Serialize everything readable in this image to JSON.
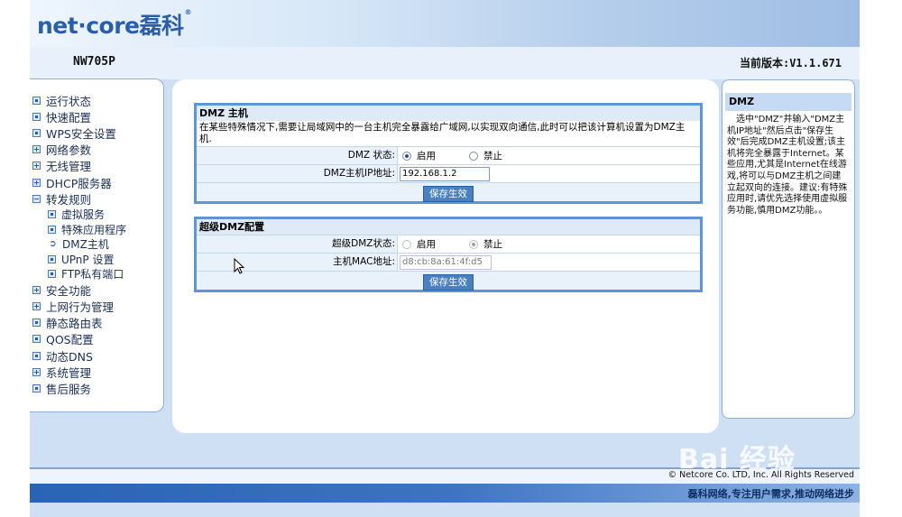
{
  "header": {
    "logo_text": "net·core磊科",
    "reg_mark": "®",
    "model": "NW705P",
    "version": "当前版本:V1.1.671"
  },
  "sidebar": {
    "items": [
      {
        "label": "运行状态",
        "icon": "dot",
        "indent": false
      },
      {
        "label": "快速配置",
        "icon": "dot",
        "indent": false
      },
      {
        "label": "WPS安全设置",
        "icon": "dot",
        "indent": false
      },
      {
        "label": "网络参数",
        "icon": "plus",
        "indent": false
      },
      {
        "label": "无线管理",
        "icon": "plus",
        "indent": false
      },
      {
        "label": "DHCP服务器",
        "icon": "plus",
        "indent": false
      },
      {
        "label": "转发规则",
        "icon": "minus",
        "indent": false
      },
      {
        "label": "虚拟服务",
        "icon": "dot",
        "indent": true
      },
      {
        "label": "特殊应用程序",
        "icon": "dot",
        "indent": true
      },
      {
        "label": "DMZ主机",
        "icon": "arrow",
        "indent": true
      },
      {
        "label": "UPnP 设置",
        "icon": "dot",
        "indent": true
      },
      {
        "label": "FTP私有端口",
        "icon": "dot",
        "indent": true
      },
      {
        "label": "安全功能",
        "icon": "plus",
        "indent": false
      },
      {
        "label": "上网行为管理",
        "icon": "plus",
        "indent": false
      },
      {
        "label": "静态路由表",
        "icon": "dot",
        "indent": false
      },
      {
        "label": "QOS配置",
        "icon": "dot",
        "indent": false
      },
      {
        "label": "动态DNS",
        "icon": "dot",
        "indent": false
      },
      {
        "label": "系统管理",
        "icon": "plus",
        "indent": false
      },
      {
        "label": "售后服务",
        "icon": "dot",
        "indent": false
      }
    ]
  },
  "dmz": {
    "title": "DMZ 主机",
    "description": "在某些特殊情况下,需要让局域网中的一台主机完全暴露给广域网,以实现双向通信,此时可以把该计算机设置为DMZ主机.",
    "status_label": "DMZ 状态:",
    "enable_label": "启用",
    "disable_label": "禁止",
    "status_value": "启用",
    "ip_label": "DMZ主机IP地址:",
    "ip_value": "192.168.1.2",
    "save_label": "保存生效"
  },
  "super_dmz": {
    "title": "超级DMZ配置",
    "status_label": "超级DMZ状态:",
    "enable_label": "启用",
    "disable_label": "禁止",
    "status_value": "禁止",
    "mac_label": "主机MAC地址:",
    "mac_value": "d8:cb:8a:61:4f:d5",
    "save_label": "保存生效"
  },
  "help": {
    "title": "DMZ",
    "body": "选中\"DMZ\"并输入\"DMZ主机IP地址\"然后点击\"保存生效\"后完成DMZ主机设置;该主机将完全暴露于Internet。某些应用,尤其是Internet在线游戏,将可以与DMZ主机之间建立起双向的连接。建议:有特殊应用时,请优先选择使用虚拟服务功能,慎用DMZ功能。。"
  },
  "footer": {
    "copyright": "© Netcore Co. LTD, Inc. All Rights Reserved",
    "slogan": "磊科网络,专注用户需求,推动网络进步"
  },
  "watermark": "Bai 经验",
  "colors": {
    "frame_bg": "#cfe0f4",
    "section_border": "#5d95d6",
    "button_bg": "#4a7fc0",
    "logo_blue": "#2a5ea8"
  }
}
